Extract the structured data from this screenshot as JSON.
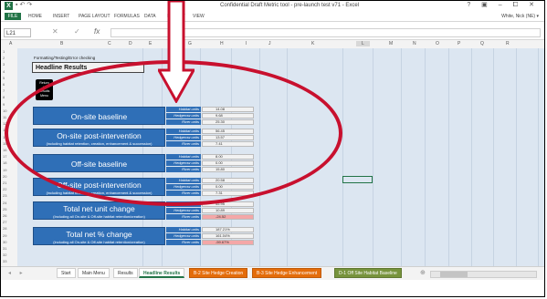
{
  "window": {
    "app_icon": "X",
    "title": "Confidential Draft Metric tool - pre-launch test v71 - Excel",
    "controls": "? ▣ – ⧠ ✕"
  },
  "ribbon": {
    "file": "FILE",
    "tabs": [
      "HOME",
      "INSERT",
      "PAGE LAYOUT",
      "FORMULAS",
      "DATA",
      "REVIEW",
      "VIEW"
    ],
    "user": "White, Nick (NE) ▾"
  },
  "formula_bar": {
    "name_box": "L21",
    "cancel": "✕",
    "enter": "✓",
    "fx": "fx",
    "value": ""
  },
  "columns": [
    "A",
    "B",
    "C",
    "D",
    "E",
    "F",
    "G",
    "H",
    "I",
    "J",
    "K",
    "L",
    "M",
    "N",
    "O",
    "P",
    "Q",
    "R"
  ],
  "rows": [
    "1",
    "2",
    "3",
    "4",
    "5",
    "6",
    "7",
    "8",
    "9",
    "10",
    "11",
    "12",
    "13",
    "14",
    "15",
    "16",
    "17",
    "18",
    "19",
    "20",
    "21",
    "22",
    "23",
    "24",
    "25",
    "26",
    "27",
    "28",
    "29",
    "30",
    "31",
    "32",
    "33"
  ],
  "sheet": {
    "formatting_label": "Formatting/Testing/Error checking",
    "headline_title": "Headline Results",
    "return_button": [
      "Return",
      "to",
      "Results",
      "Menu"
    ],
    "sections": [
      {
        "title": "On-site baseline",
        "subtitle": "",
        "labels": [
          "Habitat units",
          "Hedgerow units",
          "River units"
        ],
        "values": [
          "14.08",
          "9.68",
          "25.30"
        ]
      },
      {
        "title": "On-site post-intervention",
        "subtitle": "(including habitat retention, creation, enhancement & succession)",
        "labels": [
          "Habitat units",
          "Hedgerow units",
          "River units"
        ],
        "values": [
          "56.45",
          "13.57",
          "7.41"
        ]
      },
      {
        "title": "Off-site baseline",
        "subtitle": "",
        "labels": [
          "Habitat units",
          "Hedgerow units",
          "River units"
        ],
        "values": [
          "8.00",
          "0.00",
          "15.80"
        ]
      },
      {
        "title": "Off-site post-intervention",
        "subtitle": "(including habitat retention, creation, enhancement & succession)",
        "labels": [
          "Habitat units",
          "Hedgerow units",
          "River units"
        ],
        "values": [
          "20.58",
          "0.00",
          "7.31"
        ]
      },
      {
        "title": "Total net unit change",
        "subtitle": "(Including all On-site & Off-site habitat retention/creation)",
        "labels": [
          "Habitat units",
          "Hedgerow units",
          "River units"
        ],
        "values": [
          "45.95",
          "10.89",
          "-24.52"
        ],
        "negative": [
          false,
          false,
          true
        ]
      },
      {
        "title": "Total net % change",
        "subtitle": "(including all On-site & Off-site habitat retention/creation)",
        "labels": [
          "Habitat units",
          "Hedgerow units",
          "River units"
        ],
        "values": [
          "187.21%",
          "161.04%",
          "-59.67%"
        ],
        "negative": [
          false,
          false,
          true
        ]
      }
    ]
  },
  "sheet_tabs": {
    "nav": "◂ ▸",
    "tabs": [
      {
        "label": "Start",
        "style": "plain"
      },
      {
        "label": "Main Menu",
        "style": "plain"
      },
      {
        "label": "Results",
        "style": "plain"
      },
      {
        "label": "Headline Results",
        "style": "active"
      },
      {
        "label": "B-2 Site Hedge Creation",
        "style": "orange"
      },
      {
        "label": "B-3 Site Hedge Enhancement",
        "style": "orange"
      },
      {
        "label": "D-1 Off Site Habitat Baseline",
        "style": "green"
      }
    ],
    "add": "⊕"
  },
  "colors": {
    "excel_green": "#217346",
    "section_blue": "#2f6fb7",
    "sheet_bg": "#dce6f1",
    "annotation_red": "#c8102e",
    "negative_cell": "#f4a7a7"
  }
}
